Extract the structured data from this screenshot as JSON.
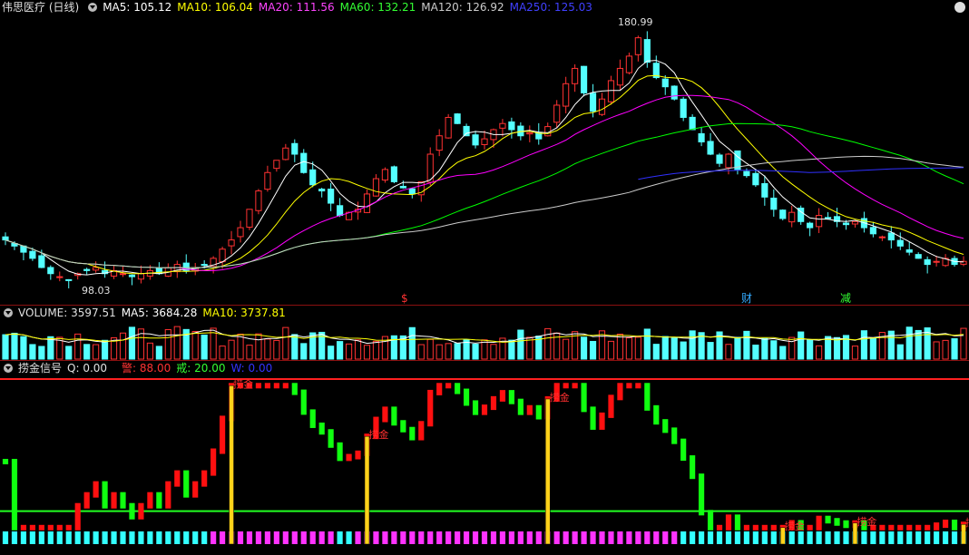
{
  "main_header": {
    "title": "伟思医疗 (日线)",
    "ma5": "MA5: 105.12",
    "ma10": "MA10: 106.04",
    "ma20": "MA20: 111.56",
    "ma60": "MA60: 132.21",
    "ma120": "MA120: 126.92",
    "ma250": "MA250: 125.03"
  },
  "volume_header": {
    "title": "VOLUME: 3597.51",
    "ma5": "MA5: 3684.28",
    "ma10": "MA10: 3737.81"
  },
  "indicator_header": {
    "title": "捞金信号",
    "q": "Q: 0.00",
    "warn": "警: 88.00",
    "ring": "戒: 20.00",
    "w": "W: 0.00"
  },
  "annotations": {
    "high_label": "180.99",
    "low_label": "98.03",
    "marker_dollar": "$",
    "marker_cai": "财",
    "marker_jian": "减",
    "signal_label": "捞金"
  },
  "colors": {
    "up": "#ff3232",
    "down": "#54ffff",
    "ma5": "#ffffff",
    "ma10": "#ffff00",
    "ma20": "#ff00ff",
    "ma60": "#00ff00",
    "ma120": "#cccccc",
    "ma250": "#3030ff",
    "signal_bar": "#ffd21a"
  },
  "chart_data": [
    {
      "type": "candlestick",
      "title": "伟思医疗 (日线)",
      "series": [
        {
          "name": "MA5",
          "last": 105.12
        },
        {
          "name": "MA10",
          "last": 106.04
        },
        {
          "name": "MA20",
          "last": 111.56
        },
        {
          "name": "MA60",
          "last": 132.21
        },
        {
          "name": "MA120",
          "last": 126.92
        },
        {
          "name": "MA250",
          "last": 125.03
        }
      ],
      "ylim": [
        95,
        185
      ],
      "high": 180.99,
      "low": 98.03,
      "close": [
        112,
        110,
        108,
        106,
        103,
        101,
        100,
        99,
        101,
        102,
        103,
        101,
        102,
        101,
        100,
        101,
        102,
        101,
        103,
        104,
        102,
        103,
        104,
        106,
        109,
        112,
        116,
        122,
        128,
        134,
        138,
        142,
        140,
        134,
        130,
        128,
        124,
        120,
        121,
        122,
        127,
        132,
        135,
        131,
        129,
        127,
        131,
        140,
        146,
        152,
        150,
        146,
        143,
        145,
        148,
        150,
        148,
        146,
        147,
        145,
        149,
        156,
        163,
        168,
        160,
        154,
        158,
        164,
        168,
        172,
        178,
        170,
        165,
        162,
        158,
        152,
        148,
        144,
        140,
        137,
        140,
        135,
        133,
        130,
        126,
        122,
        119,
        121,
        118,
        116,
        120,
        119,
        118,
        117,
        118,
        116,
        114,
        113,
        112,
        110,
        108,
        106,
        104,
        105,
        106,
        104,
        105
      ]
    },
    {
      "type": "bar",
      "title": "VOLUME: 3597.51",
      "series": [
        {
          "name": "MA5",
          "last": 3684.28
        },
        {
          "name": "MA10",
          "last": 3737.81
        }
      ]
    },
    {
      "type": "bar",
      "title": "捞金信号",
      "levels": {
        "警": 88.0,
        "戒": 20.0,
        "Q": 0.0,
        "W": 0.0
      },
      "ylim": [
        0,
        100
      ],
      "signal_positions": [
        31,
        49,
        74,
        105,
        115,
        130
      ]
    }
  ]
}
